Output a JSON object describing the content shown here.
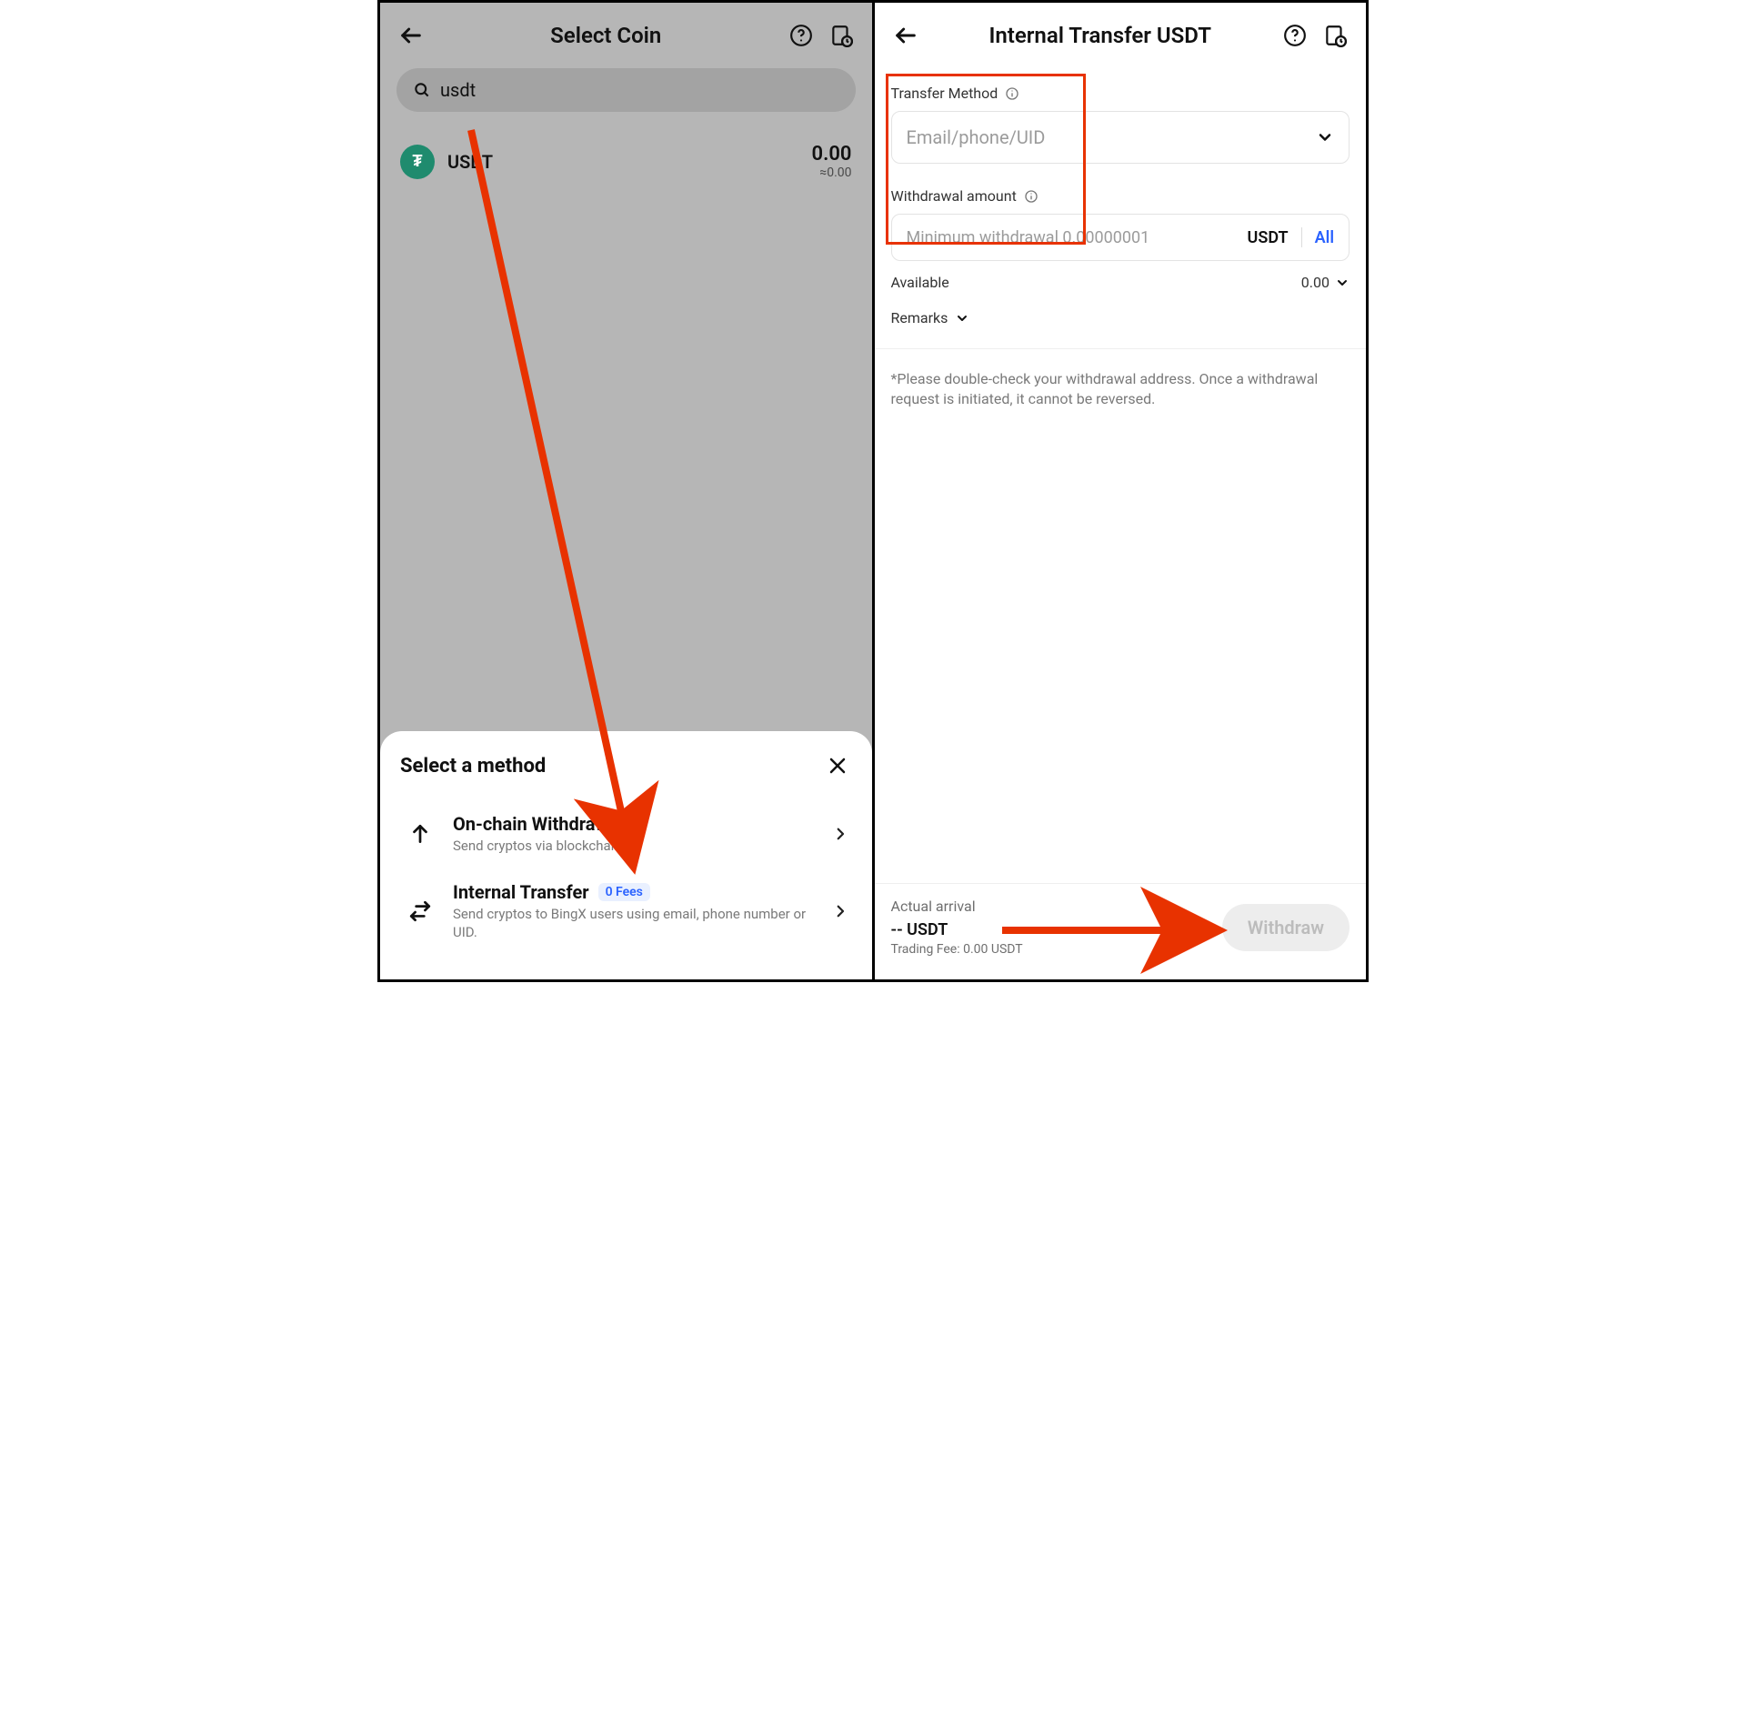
{
  "left": {
    "title": "Select Coin",
    "search": {
      "value": "usdt"
    },
    "coin": {
      "symbol": "USDT",
      "badge": "₮",
      "balance": "0.00",
      "balance_sub": "≈0.00"
    },
    "sheet": {
      "title": "Select a method",
      "methods": [
        {
          "title": "On-chain Withdrawal",
          "desc": "Send cryptos via blockchains."
        },
        {
          "title": "Internal Transfer",
          "badge": "0 Fees",
          "desc": "Send cryptos to BingX users using email, phone number or UID."
        }
      ]
    }
  },
  "right": {
    "title": "Internal Transfer USDT",
    "transfer_method": {
      "label": "Transfer Method",
      "placeholder": "Email/phone/UID"
    },
    "amount": {
      "label": "Withdrawal amount",
      "placeholder": "Minimum withdrawal 0.00000001",
      "unit": "USDT",
      "all": "All"
    },
    "available": {
      "label": "Available",
      "value": "0.00"
    },
    "remarks": {
      "label": "Remarks"
    },
    "warning": "*Please double-check your withdrawal address. Once a withdrawal request is initiated, it cannot be reversed.",
    "footer": {
      "actual_label": "Actual arrival",
      "amount_line": "-- USDT",
      "fee_line": "Trading Fee: 0.00 USDT",
      "withdraw_label": "Withdraw"
    }
  }
}
